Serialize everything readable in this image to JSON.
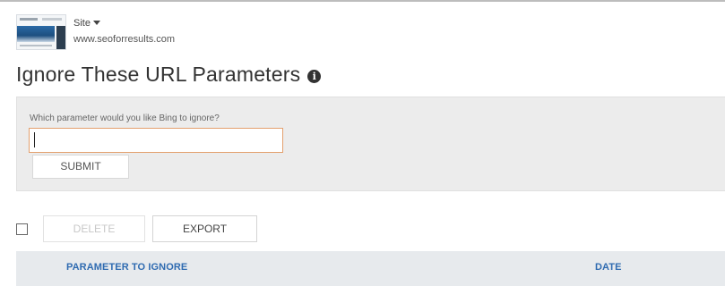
{
  "site": {
    "selector_label": "Site",
    "url": "www.seoforresults.com"
  },
  "page": {
    "title": "Ignore These URL Parameters"
  },
  "form": {
    "prompt": "Which parameter would you like Bing to ignore?",
    "input_value": "",
    "input_placeholder": "",
    "submit_label": "SUBMIT"
  },
  "toolbar": {
    "delete_label": "DELETE",
    "export_label": "EXPORT"
  },
  "table": {
    "columns": [
      "PARAMETER TO IGNORE",
      "DATE"
    ],
    "rows": []
  },
  "colors": {
    "link_blue": "#2f6bb1",
    "input_focus_border": "#e3a06e",
    "panel_bg": "#ececec",
    "table_header_bg": "#e7eaed"
  },
  "icons": {
    "info": "info-icon",
    "site_dropdown": "chevron-down-icon",
    "site_thumbnail": "site-thumbnail"
  }
}
